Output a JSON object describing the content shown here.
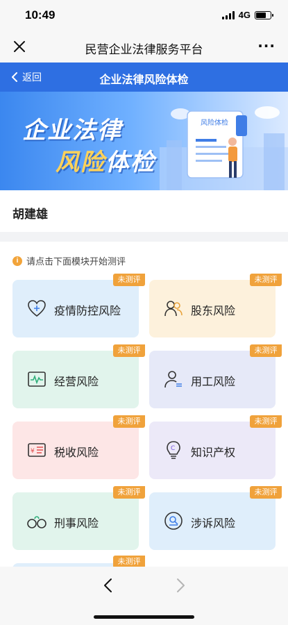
{
  "status": {
    "time": "10:49",
    "network": "4G",
    "battery_level": 0.75
  },
  "wechat": {
    "title": "民营企业法律服务平台",
    "close_icon": "close-icon",
    "more_label": "···"
  },
  "nav": {
    "back_label": "返回",
    "title": "企业法律风险体检"
  },
  "banner": {
    "line1": "企业法律",
    "line2_highlight": "风险",
    "line2_rest": "体检",
    "doc_title": "风险体检"
  },
  "user": {
    "name": "胡建雄"
  },
  "hint": {
    "icon_char": "i",
    "text": "请点击下面模块开始测评"
  },
  "modules": [
    {
      "label": "疫情防控风险",
      "badge": "未测评",
      "icon": "heart-plus-icon"
    },
    {
      "label": "股东风险",
      "badge": "未测评",
      "icon": "shareholders-icon"
    },
    {
      "label": "经营风险",
      "badge": "未测评",
      "icon": "pulse-chart-icon"
    },
    {
      "label": "用工风险",
      "badge": "未测评",
      "icon": "employee-icon"
    },
    {
      "label": "税收风险",
      "badge": "未测评",
      "icon": "tax-receipt-icon"
    },
    {
      "label": "知识产权",
      "badge": "未测评",
      "icon": "lightbulb-copyright-icon"
    },
    {
      "label": "刑事风险",
      "badge": "未测评",
      "icon": "handcuffs-icon"
    },
    {
      "label": "涉诉风险",
      "badge": "未测评",
      "icon": "lawsuit-icon"
    },
    {
      "label": "",
      "badge": "未测评",
      "icon": ""
    }
  ],
  "colors": {
    "nav_blue": "#2e6fe2",
    "badge_orange": "#f0a23b",
    "card_blue": "#dfeefb",
    "card_yellow": "#fdf1dc",
    "card_green": "#e1f4ec",
    "card_lavender": "#e6e9f8",
    "card_pink": "#fde6e6",
    "card_purple": "#ece9f8"
  }
}
